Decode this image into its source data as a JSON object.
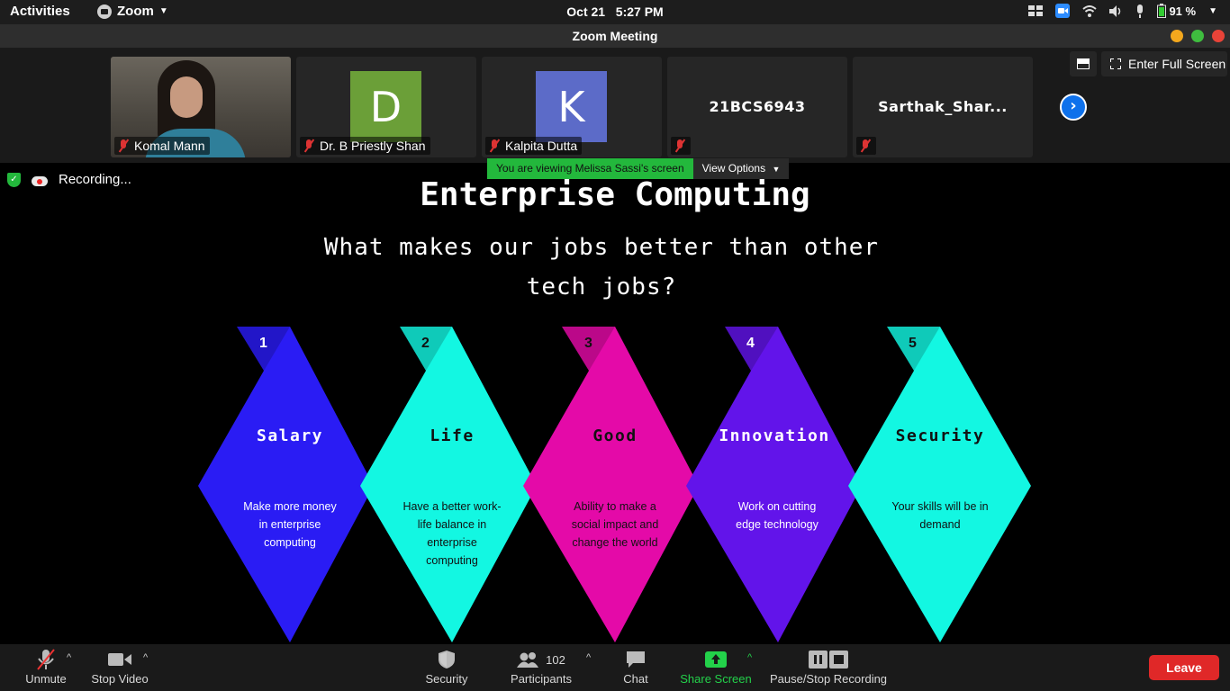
{
  "topbar": {
    "activities": "Activities",
    "app_name": "Zoom",
    "date": "Oct 21",
    "time": "5:27 PM",
    "battery": "91 %"
  },
  "window": {
    "title": "Zoom Meeting"
  },
  "gallery": {
    "participants": [
      {
        "name": "Komal Mann",
        "type": "video"
      },
      {
        "name": "Dr. B Priestly Shan",
        "type": "avatar",
        "initial": "D",
        "color": "#6b9f38"
      },
      {
        "name": "Kalpita Dutta",
        "type": "avatar",
        "initial": "K",
        "color": "#5c6bc8"
      },
      {
        "name": "21BCS6943",
        "type": "name"
      },
      {
        "name": "Sarthak_Shar...",
        "type": "name"
      }
    ],
    "full_screen_label": "Enter Full Screen"
  },
  "share": {
    "viewing_text": "You are viewing Melissa Sassi's screen",
    "view_options": "View Options",
    "recording": "Recording..."
  },
  "slide": {
    "title": "Enterprise Computing",
    "subtitle": "What makes our jobs better than other tech jobs?",
    "items": [
      {
        "num": "1",
        "title": "Salary",
        "desc": "Make more money in enterprise computing",
        "color": "#2a1cf4",
        "text_color": "#ffffff"
      },
      {
        "num": "2",
        "title": "Life",
        "desc": "Have a better work-life balance in enterprise computing",
        "color": "#13f7e2",
        "text_color": "#111111"
      },
      {
        "num": "3",
        "title": "Good",
        "desc": "Ability to make a social impact and change the world",
        "color": "#e40aa8",
        "text_color": "#111111"
      },
      {
        "num": "4",
        "title": "Innovation",
        "desc": "Work on cutting edge technology",
        "color": "#6214ea",
        "text_color": "#ffffff"
      },
      {
        "num": "5",
        "title": "Security",
        "desc": "Your skills will be in demand",
        "color": "#13f7e2",
        "text_color": "#111111"
      }
    ]
  },
  "toolbar": {
    "unmute": "Unmute",
    "stop_video": "Stop Video",
    "security": "Security",
    "participants": "Participants",
    "participant_count": "102",
    "chat": "Chat",
    "share_screen": "Share Screen",
    "recording": "Pause/Stop Recording",
    "leave": "Leave"
  }
}
